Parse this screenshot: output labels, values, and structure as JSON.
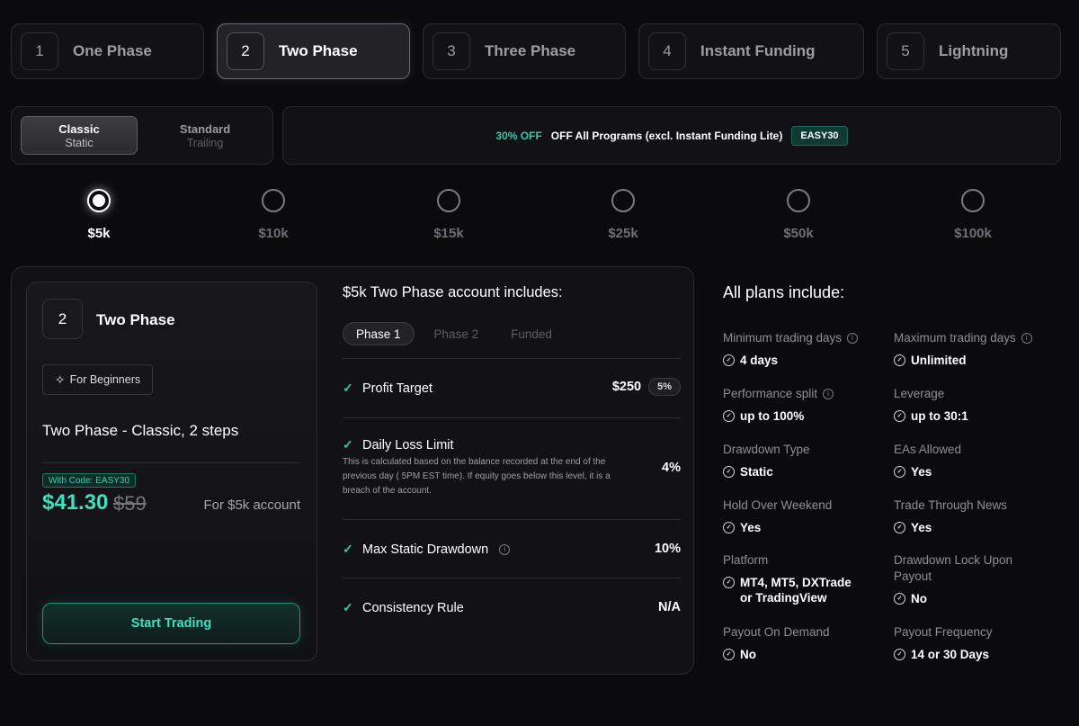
{
  "program_tabs": [
    {
      "num": "1",
      "label": "One Phase"
    },
    {
      "num": "2",
      "label": "Two Phase"
    },
    {
      "num": "3",
      "label": "Three Phase"
    },
    {
      "num": "4",
      "label": "Instant Funding"
    },
    {
      "num": "5",
      "label": "Lightning"
    }
  ],
  "mode_switch": {
    "classic_title": "Classic",
    "classic_sub": "Static",
    "standard_title": "Standard",
    "standard_sub": "Trailing"
  },
  "promo": {
    "off": "30% OFF",
    "text": "OFF All Programs (excl. Instant Funding Lite)",
    "code": "EASY30"
  },
  "sizes": [
    "$5k",
    "$10k",
    "$15k",
    "$25k",
    "$50k",
    "$100k"
  ],
  "plan_card": {
    "num": "2",
    "name": "Two Phase",
    "badge": "For Beginners",
    "description": "Two Phase - Classic, 2 steps",
    "code_tag": "With Code: EASY30",
    "price_new": "$41.30",
    "price_old": "$59",
    "price_for": "For $5k account",
    "cta": "Start Trading"
  },
  "includes": {
    "title": "$5k Two Phase account includes:",
    "phase_tabs": [
      "Phase 1",
      "Phase 2",
      "Funded"
    ],
    "rules": [
      {
        "title": "Profit Target",
        "value": "$250",
        "pill": "5%"
      },
      {
        "title": "Daily Loss Limit",
        "value": "4%",
        "desc": "This is calculated based on the balance recorded at the end of the previous day ( 5PM EST time). If equity goes below this level, it is a breach of the account."
      },
      {
        "title": "Max Static Drawdown",
        "value": "10%"
      },
      {
        "title": "Consistency Rule",
        "value": "N/A"
      }
    ]
  },
  "all_plans": {
    "title": "All plans include:",
    "features": [
      {
        "label": "Minimum trading days",
        "value": "4 days",
        "info": true
      },
      {
        "label": "Maximum trading days",
        "value": "Unlimited",
        "info": true
      },
      {
        "label": "Performance split",
        "value": "up to 100%",
        "info": true
      },
      {
        "label": "Leverage",
        "value": "up to 30:1"
      },
      {
        "label": "Drawdown Type",
        "value": "Static"
      },
      {
        "label": "EAs Allowed",
        "value": "Yes"
      },
      {
        "label": "Hold Over Weekend",
        "value": "Yes"
      },
      {
        "label": "Trade Through News",
        "value": "Yes"
      },
      {
        "label": "Platform",
        "value": "MT4, MT5, DXTrade or TradingView"
      },
      {
        "label": "Drawdown Lock Upon Payout",
        "value": "No"
      },
      {
        "label": "Payout On Demand",
        "value": "No"
      },
      {
        "label": "Payout Frequency",
        "value": "14 or 30 Days"
      }
    ]
  }
}
